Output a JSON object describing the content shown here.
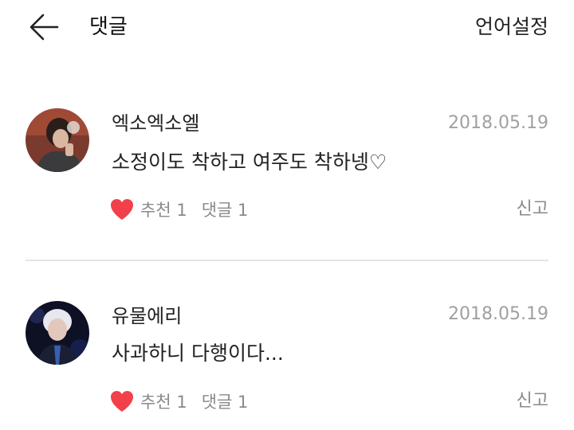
{
  "header": {
    "back_icon": "arrow-left-icon",
    "title": "댓글",
    "language_settings": "언어설정"
  },
  "comments": [
    {
      "author": "엑소엑소엘",
      "date": "2018.05.19",
      "text": "소정이도 착하고 여주도 착하넹♡",
      "like_label": "추천 1",
      "reply_label": "댓글 1",
      "report_label": "신고"
    },
    {
      "author": "유물에리",
      "date": "2018.05.19",
      "text": "사과하니 다행이다...",
      "like_label": "추천 1",
      "reply_label": "댓글 1",
      "report_label": "신고"
    }
  ],
  "colors": {
    "heart": "#f2404a",
    "meta_text": "#a0a0a0",
    "divider": "#e4e4e4"
  }
}
